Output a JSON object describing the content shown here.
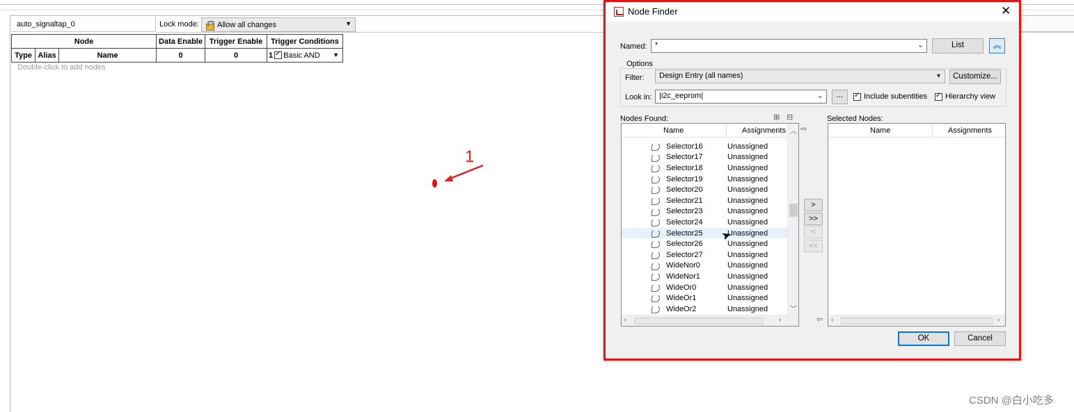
{
  "editor": {
    "instance_name": "auto_signaltap_0",
    "lock_mode_label": "Lock mode:",
    "lock_mode_value": "Allow all changes",
    "table": {
      "node_header": "Node",
      "data_enable_header": "Data Enable",
      "trigger_enable_header": "Trigger Enable",
      "trigger_conditions_header": "Trigger Conditions",
      "type_header": "Type",
      "alias_header": "Alias",
      "name_header": "Name",
      "data_enable_count": "0",
      "trigger_enable_count": "0",
      "trigger_condition_index": "1",
      "trigger_condition_value": "Basic AND"
    },
    "hint": "Double-click to add nodes"
  },
  "annotation": {
    "number": "1",
    "color": "#e02020"
  },
  "watermark": "CSDN @白小吃多",
  "dialog": {
    "title": "Node Finder",
    "named_label": "Named:",
    "named_value": "*",
    "list_button": "List",
    "options_label": "Options",
    "filter_label": "Filter:",
    "filter_value": "Design Entry (all names)",
    "customize_button": "Customize...",
    "look_in_label": "Look in:",
    "look_in_value": "|i2c_eeprom|",
    "browse_button": "...",
    "include_subentities": {
      "label": "Include subentities",
      "checked": true
    },
    "hierarchy_view": {
      "label": "Hierarchy view",
      "checked": true
    },
    "nodes_found_label": "Nodes Found:",
    "selected_nodes_label": "Selected Nodes:",
    "col_name": "Name",
    "col_assignments": "Assignments",
    "nodes_found": [
      {
        "name": "Selector16",
        "assignment": "Unassigned"
      },
      {
        "name": "Selector17",
        "assignment": "Unassigned"
      },
      {
        "name": "Selector18",
        "assignment": "Unassigned"
      },
      {
        "name": "Selector19",
        "assignment": "Unassigned"
      },
      {
        "name": "Selector20",
        "assignment": "Unassigned"
      },
      {
        "name": "Selector21",
        "assignment": "Unassigned"
      },
      {
        "name": "Selector23",
        "assignment": "Unassigned"
      },
      {
        "name": "Selector24",
        "assignment": "Unassigned"
      },
      {
        "name": "Selector25",
        "assignment": "Unassigned",
        "selected": true
      },
      {
        "name": "Selector26",
        "assignment": "Unassigned"
      },
      {
        "name": "Selector27",
        "assignment": "Unassigned"
      },
      {
        "name": "WideNor0",
        "assignment": "Unassigned"
      },
      {
        "name": "WideNor1",
        "assignment": "Unassigned"
      },
      {
        "name": "WideOr0",
        "assignment": "Unassigned"
      },
      {
        "name": "WideOr1",
        "assignment": "Unassigned"
      },
      {
        "name": "WideOr2",
        "assignment": "Unassigned"
      }
    ],
    "move_buttons": {
      "add_one": ">",
      "add_all": ">>",
      "remove_one": "<",
      "remove_all": "<<"
    },
    "ok_button": "OK",
    "cancel_button": "Cancel",
    "accent_color": "#0078d7",
    "frame_color": "#e01515"
  }
}
